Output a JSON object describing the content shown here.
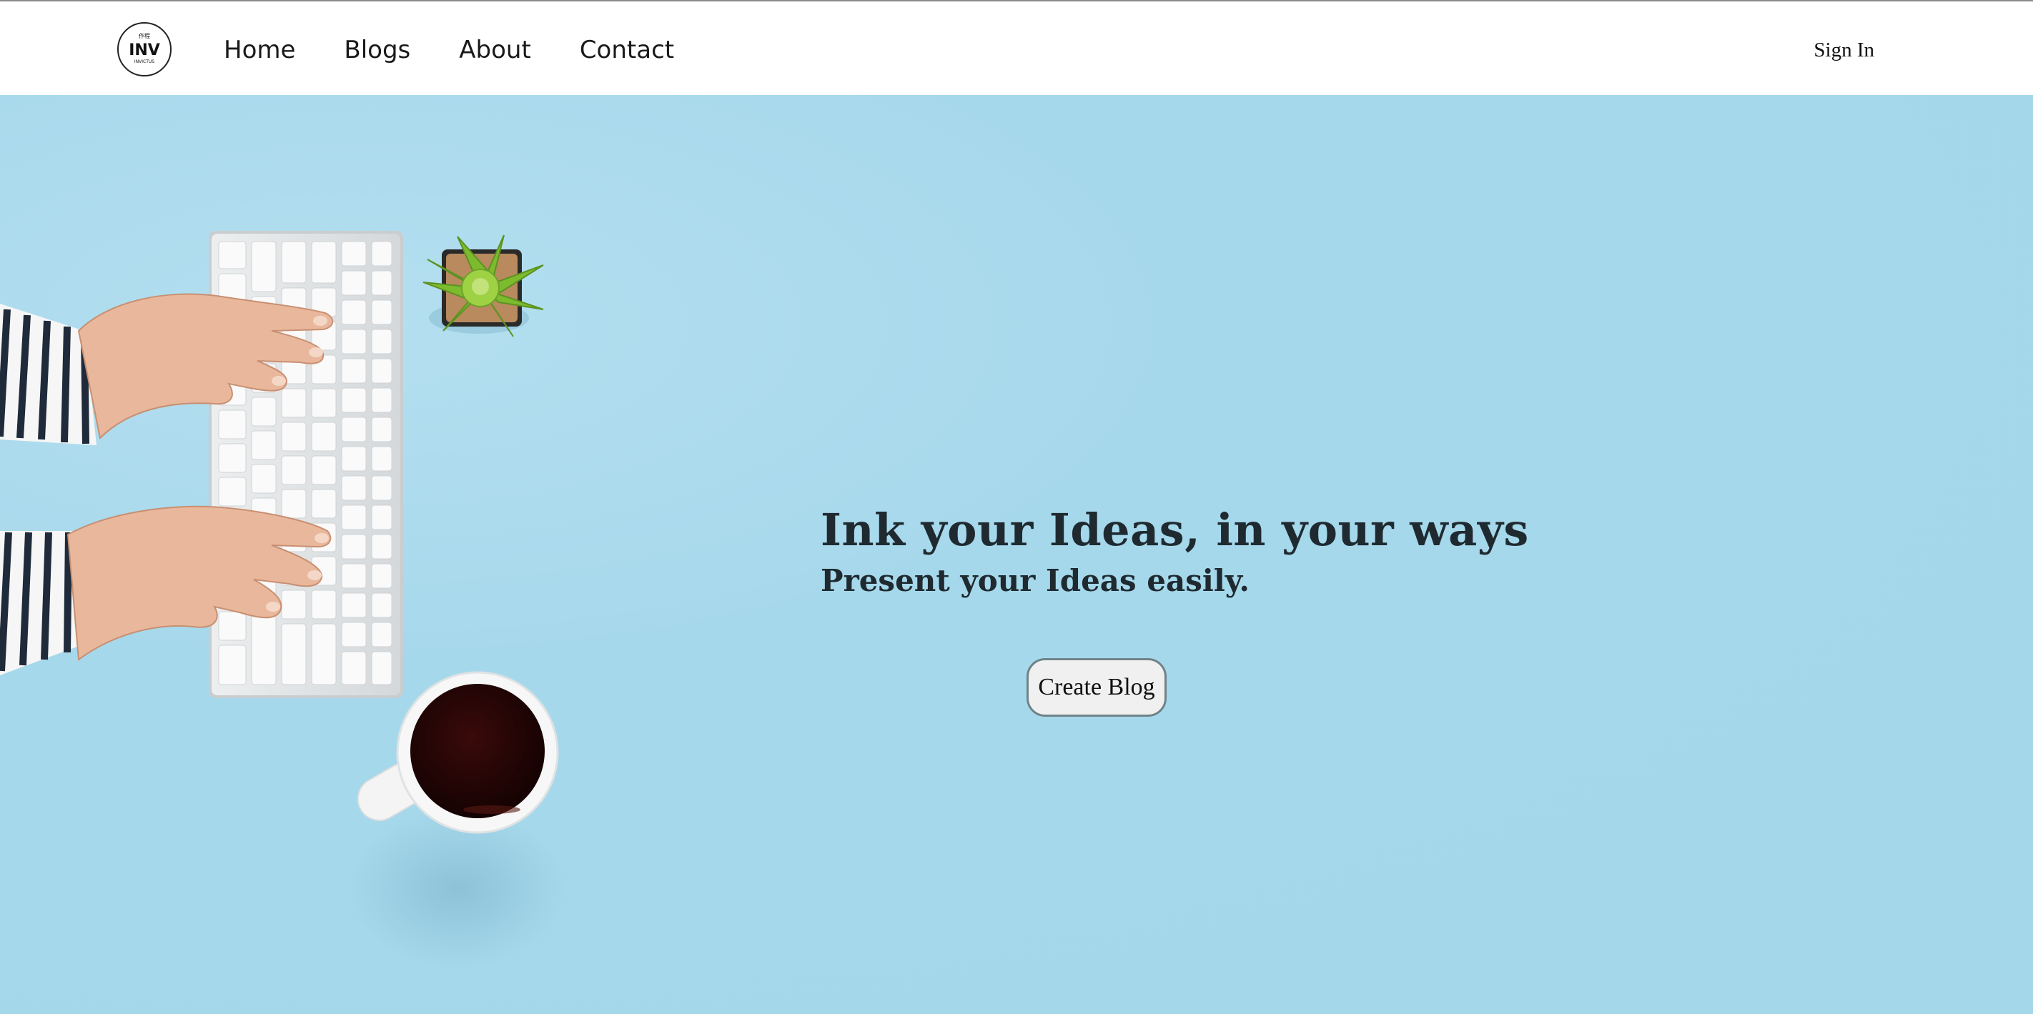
{
  "brand": {
    "logo_text": "INV",
    "logo_subtext": "INVICTUS",
    "logo_mark": "作程"
  },
  "nav": {
    "links": [
      {
        "label": "Home"
      },
      {
        "label": "Blogs"
      },
      {
        "label": "About"
      },
      {
        "label": "Contact"
      }
    ],
    "sign_in_label": "Sign In"
  },
  "hero": {
    "title": "Ink your Ideas, in your ways",
    "subtitle": "Present your Ideas easily.",
    "cta_label": "Create Blog",
    "background_color": "#a4d7ea",
    "image_content": [
      "hands-typing-keyboard",
      "succulent-plant",
      "coffee-cup"
    ]
  }
}
